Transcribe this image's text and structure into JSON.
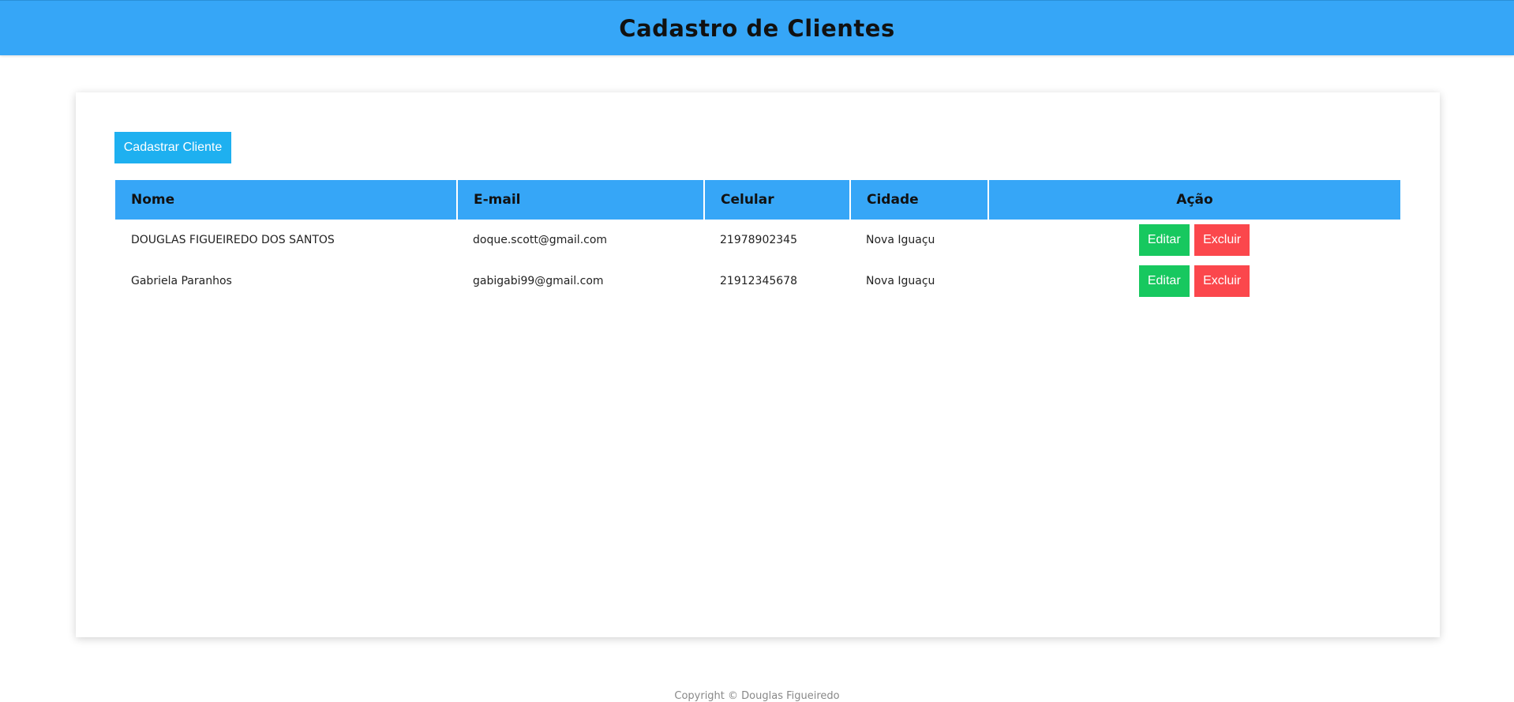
{
  "header": {
    "title": "Cadastro de Clientes"
  },
  "toolbar": {
    "add_label": "Cadastrar Cliente"
  },
  "table": {
    "columns": [
      "Nome",
      "E-mail",
      "Celular",
      "Cidade",
      "Ação"
    ],
    "rows": [
      {
        "nome": "DOUGLAS FIGUEIREDO DOS SANTOS",
        "email": "doque.scott@gmail.com",
        "celular": "21978902345",
        "cidade": "Nova Iguaçu",
        "edit_label": "Editar",
        "delete_label": "Excluir"
      },
      {
        "nome": "Gabriela Paranhos",
        "email": "gabigabi99@gmail.com",
        "celular": "21912345678",
        "cidade": "Nova Iguaçu",
        "edit_label": "Editar",
        "delete_label": "Excluir"
      }
    ]
  },
  "footer": {
    "text": "Copyright © Douglas Figueiredo"
  },
  "colors": {
    "header_bg": "#36a6f7",
    "add_button": "#1eb0f0",
    "edit_button": "#17c85f",
    "delete_button": "#fb474c"
  }
}
